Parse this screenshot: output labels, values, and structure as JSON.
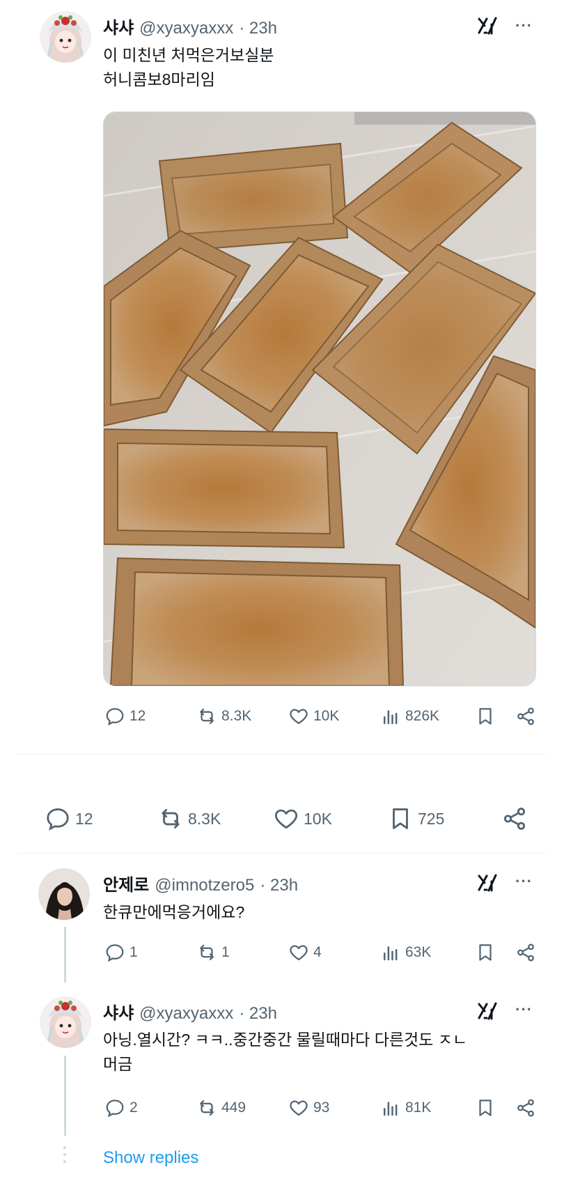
{
  "main_tweet": {
    "name": "샤샤",
    "handle": "@xyaxyaxxx",
    "time": "· 23h",
    "text_line1": "이 미친년 처먹은거보실분",
    "text_line2": "허니콤보8마리임",
    "stats": {
      "replies": "12",
      "reposts": "8.3K",
      "likes": "10K",
      "views": "826K"
    }
  },
  "detail_bar": {
    "replies": "12",
    "reposts": "8.3K",
    "likes": "10K",
    "bookmarks": "725"
  },
  "reply1": {
    "name": "안제로",
    "handle": "@imnotzero5",
    "time": "· 23h",
    "text": "한큐만에먹응거에요?",
    "stats": {
      "replies": "1",
      "reposts": "1",
      "likes": "4",
      "views": "63K"
    }
  },
  "reply2": {
    "name": "샤샤",
    "handle": "@xyaxyaxxx",
    "time": "· 23h",
    "text_line1": "아닝.열시간? ㅋㅋ..중간중간 물릴때마다 다른것도 ㅈㄴ",
    "text_line2": "머금",
    "stats": {
      "replies": "2",
      "reposts": "449",
      "likes": "93",
      "views": "81K"
    }
  },
  "show_replies": "Show replies",
  "more_glyph": "···",
  "colors": {
    "link": "#1d9bf0",
    "secondary": "#536471",
    "box": "#a77c4d",
    "floor": "#d9d6d1"
  }
}
